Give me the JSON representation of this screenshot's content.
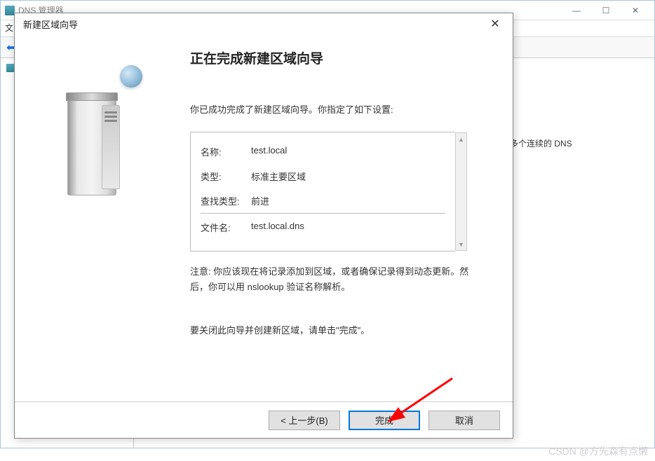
{
  "bg": {
    "title": "DNS 管理器",
    "toolbar_text": "文",
    "right_text": "个或多个连续的 DNS"
  },
  "wizard": {
    "title": "新建区域向导",
    "heading": "正在完成新建区域向导",
    "intro": "你已成功完成了新建区域向导。你指定了如下设置:",
    "summary": {
      "name_label": "名称:",
      "name_value": "test.local",
      "type_label": "类型:",
      "type_value": "标准主要区域",
      "lookup_label": "查找类型:",
      "lookup_value": "前进",
      "file_label": "文件名:",
      "file_value": "test.local.dns"
    },
    "note": "注意: 你应该现在将记录添加到区域，或者确保记录得到动态更新。然后，你可以用 nslookup 验证名称解析。",
    "close_text": "要关闭此向导并创建新区域，请单击\"完成\"。",
    "buttons": {
      "back": "< 上一步(B)",
      "finish": "完成",
      "cancel": "取消"
    }
  },
  "watermark": "CSDN @方先森有点懒"
}
